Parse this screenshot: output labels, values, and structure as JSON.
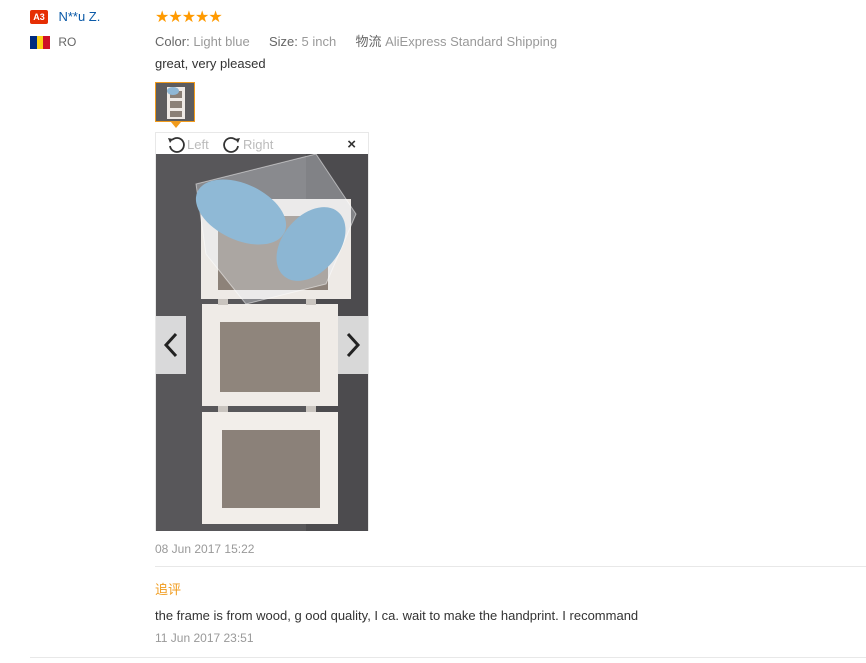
{
  "reviewer": {
    "level_badge": "A3",
    "name": "N**u Z.",
    "country_code": "RO",
    "flag_colors": [
      "#002b7f",
      "#fcd116",
      "#ce1126"
    ]
  },
  "rating": {
    "stars": 5,
    "display": "★★★★★"
  },
  "attributes": {
    "color_key": "Color:",
    "color_value": "Light blue",
    "size_key": "Size:",
    "size_value": "5 inch",
    "shipping_key": "物流",
    "shipping_value": "AliExpress Standard Shipping"
  },
  "feedback_text": "great, very pleased",
  "viewer": {
    "rotate_left_label": "Left",
    "rotate_right_label": "Right",
    "close_label": "×"
  },
  "review_date": "08 Jun 2017 15:22",
  "additional": {
    "label": "追评",
    "text": "the frame is from wood, g ood quality, I ca. wait to make the handprint. I recommand",
    "date": "11 Jun 2017 23:51"
  },
  "colors": {
    "accent": "#f19b1c",
    "star": "#ff9a00",
    "name_link": "#0b5aa8",
    "badge": "#e62e04"
  }
}
